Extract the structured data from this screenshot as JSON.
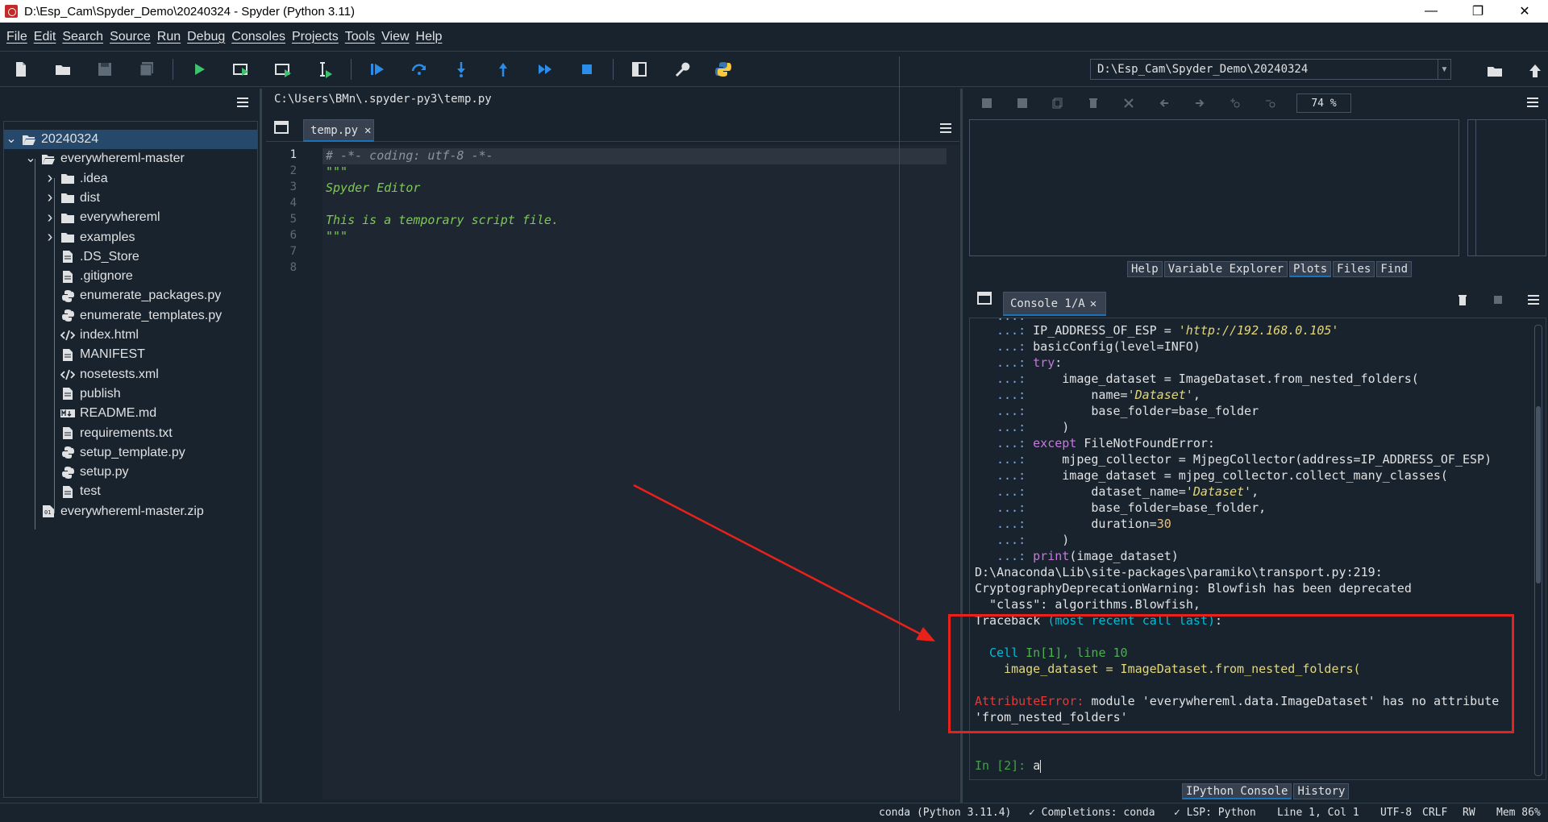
{
  "window": {
    "title": "D:\\Esp_Cam\\Spyder_Demo\\20240324 - Spyder (Python 3.11)"
  },
  "menu": [
    "File",
    "Edit",
    "Search",
    "Source",
    "Run",
    "Debug",
    "Consoles",
    "Projects",
    "Tools",
    "View",
    "Help"
  ],
  "toolbar": {
    "working_dir": "D:\\Esp_Cam\\Spyder_Demo\\20240324"
  },
  "files": {
    "root": "20240324",
    "folder": "everywhereml-master",
    "items": [
      ".idea",
      "dist",
      "everywhereml",
      "examples",
      ".DS_Store",
      ".gitignore",
      "enumerate_packages.py",
      "enumerate_templates.py",
      "index.html",
      "MANIFEST",
      "nosetests.xml",
      "publish",
      "README.md",
      "requirements.txt",
      "setup_template.py",
      "setup.py",
      "test"
    ],
    "zip": "everywhereml-master.zip"
  },
  "editor": {
    "path": "C:\\Users\\BMn\\.spyder-py3\\temp.py",
    "tab": "temp.py",
    "line_numbers": [
      "1",
      "2",
      "3",
      "4",
      "5",
      "6",
      "7",
      "8"
    ],
    "lines": [
      "# -*- coding: utf-8 -*-",
      "\"\"\"",
      "Spyder Editor",
      "",
      "This is a temporary script file.",
      "\"\"\"",
      "",
      ""
    ]
  },
  "plots": {
    "zoom": "74 %",
    "tabs": [
      "Help",
      "Variable Explorer",
      "Plots",
      "Files",
      "Find"
    ]
  },
  "console": {
    "tab": "Console 1/A",
    "prompt_cont": "...:",
    "code": {
      "l1": "IP_ADDRESS_OF_ESP = ",
      "l1s": "'http://192.168.0.105'",
      "l2": "basicConfig(level=INFO)",
      "l3kw": "try",
      "l3": ":",
      "l4": "    image_dataset = ImageDataset.from_nested_folders(",
      "l5a": "        name=",
      "l5s": "'Dataset'",
      "l5b": ",",
      "l6": "        base_folder=base_folder",
      "l7": "    )",
      "l8kw": "except",
      "l8": " FileNotFoundError:",
      "l9": "    mjpeg_collector = MjpegCollector(address=IP_ADDRESS_OF_ESP)",
      "l10": "    image_dataset = mjpeg_collector.collect_many_classes(",
      "l11a": "        dataset_name=",
      "l11s": "'Dataset'",
      "l11b": ",",
      "l12": "        base_folder=base_folder,",
      "l13a": "        duration=",
      "l13n": "30",
      "l14": "    )",
      "l15kw": "print",
      "l15": "(image_dataset)"
    },
    "warning": [
      "D:\\Anaconda\\Lib\\site-packages\\paramiko\\transport.py:219:",
      "CryptographyDeprecationWarning: Blowfish has been deprecated",
      "  \"class\": algorithms.Blowfish,"
    ],
    "tb_head": "Traceback ",
    "tb_head2": "(most recent call last)",
    "tb_head3": ":",
    "tb_cell": "Cell ",
    "tb_cell2": "In[1], line 10",
    "tb_code": "  image_dataset = ImageDataset.from_nested_folders(",
    "err_name": "AttributeError:",
    "err_msg": " module 'everywhereml.data.ImageDataset' has no attribute",
    "err_msg2": "'from_nested_folders'",
    "in_prompt": "In [2]: ",
    "input": "a",
    "tabs": [
      "IPython Console",
      "History"
    ]
  },
  "status": {
    "env": "conda (Python 3.11.4)",
    "completions": "Completions: conda",
    "lsp": "LSP: Python",
    "pos": "Line 1, Col 1",
    "enc": "UTF-8",
    "eol": "CRLF",
    "rw": "RW",
    "mem": "Mem 86%"
  }
}
